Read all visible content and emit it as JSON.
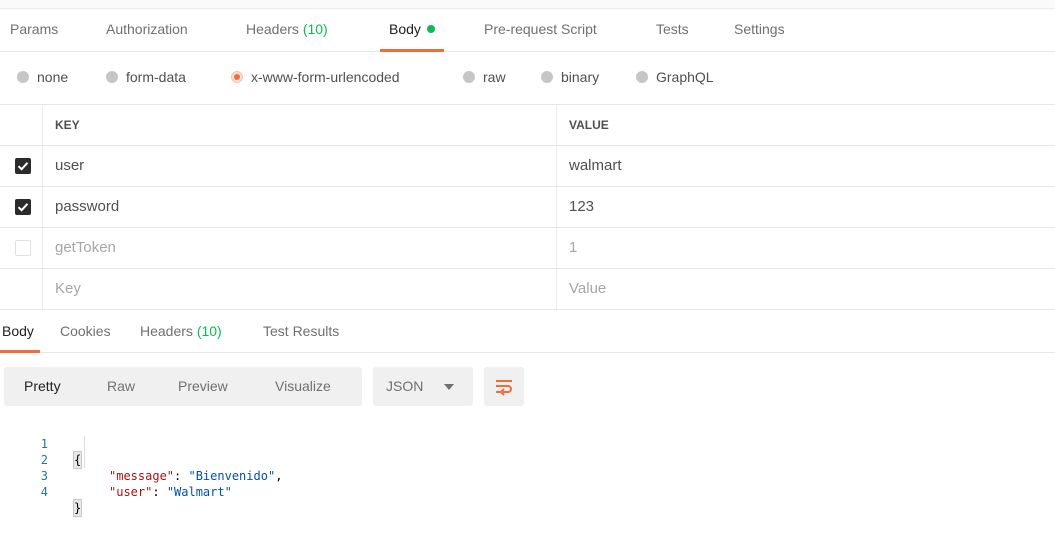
{
  "request_tabs": [
    {
      "label": "Params"
    },
    {
      "label": "Authorization"
    },
    {
      "label": "Headers",
      "count": "(10)"
    },
    {
      "label": "Body",
      "active": true
    },
    {
      "label": "Pre-request Script"
    },
    {
      "label": "Tests"
    },
    {
      "label": "Settings"
    }
  ],
  "body_modes": [
    "none",
    "form-data",
    "x-www-form-urlencoded",
    "raw",
    "binary",
    "GraphQL"
  ],
  "body_mode_selected": "x-www-form-urlencoded",
  "kv_table": {
    "headers": {
      "key": "KEY",
      "value": "VALUE"
    },
    "rows": [
      {
        "key": "user",
        "value": "walmart",
        "enabled": true
      },
      {
        "key": "password",
        "value": "123",
        "enabled": true
      },
      {
        "key": "getToken",
        "value": "1",
        "enabled": false
      }
    ],
    "placeholder": {
      "key": "Key",
      "value": "Value"
    }
  },
  "response_tabs": [
    {
      "label": "Body",
      "active": true
    },
    {
      "label": "Cookies"
    },
    {
      "label": "Headers",
      "count": "(10)"
    },
    {
      "label": "Test Results"
    }
  ],
  "view_modes": [
    "Pretty",
    "Raw",
    "Preview",
    "Visualize"
  ],
  "view_mode_selected": "Pretty",
  "format": "JSON",
  "code": {
    "line_numbers": [
      "1",
      "2",
      "3",
      "4"
    ],
    "open_brace": "{",
    "close_brace": "}",
    "line2_key": "\"message\"",
    "line2_sep": ": ",
    "line2_val": "\"Bienvenido\"",
    "line2_end": ",",
    "line3_key": "\"user\"",
    "line3_sep": ": ",
    "line3_val": "\"Walmart\""
  },
  "colors": {
    "accent": "#f26b3a",
    "count_green": "#0cbb52",
    "json_key": "#a31515",
    "json_string": "#0451a5",
    "line_number": "#237893"
  },
  "icons": {
    "checkbox_checked": "check-icon",
    "format_caret": "caret-down-icon",
    "wrap": "wrap-lines-icon"
  }
}
